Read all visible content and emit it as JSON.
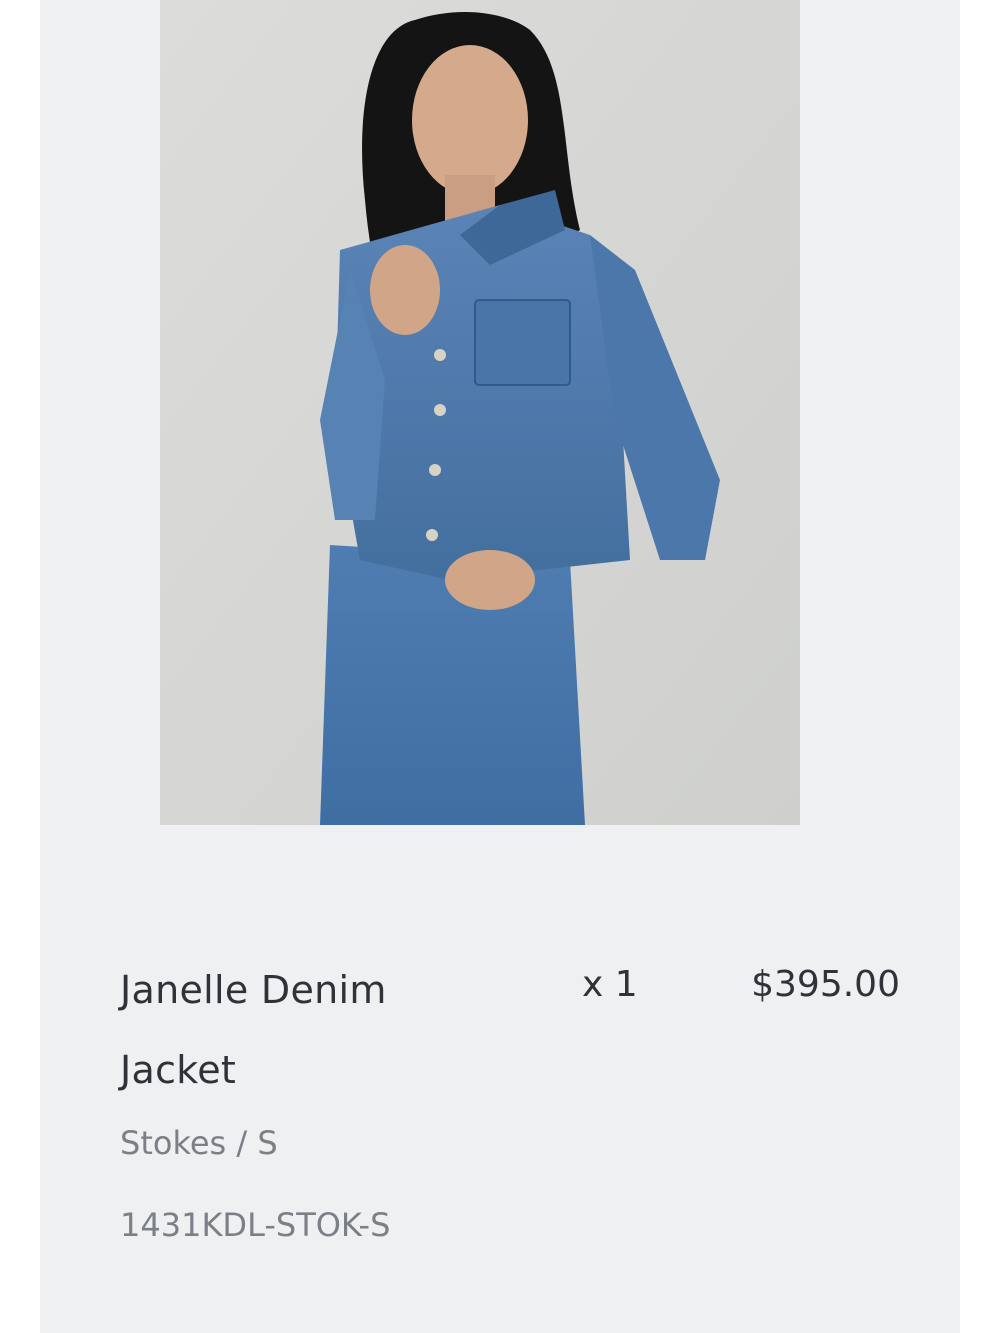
{
  "product": {
    "image_alt": "Model wearing denim jacket and jeans",
    "name": "Janelle Denim Jacket",
    "quantity": "x 1",
    "price": "$395.00",
    "variant": "Stokes / S",
    "sku": "1431KDL-STOK-S"
  },
  "colors": {
    "card_background": "#eff0f2",
    "text_primary": "#2f3238",
    "text_secondary": "#7b7f86",
    "denim": "#4f79ab"
  }
}
